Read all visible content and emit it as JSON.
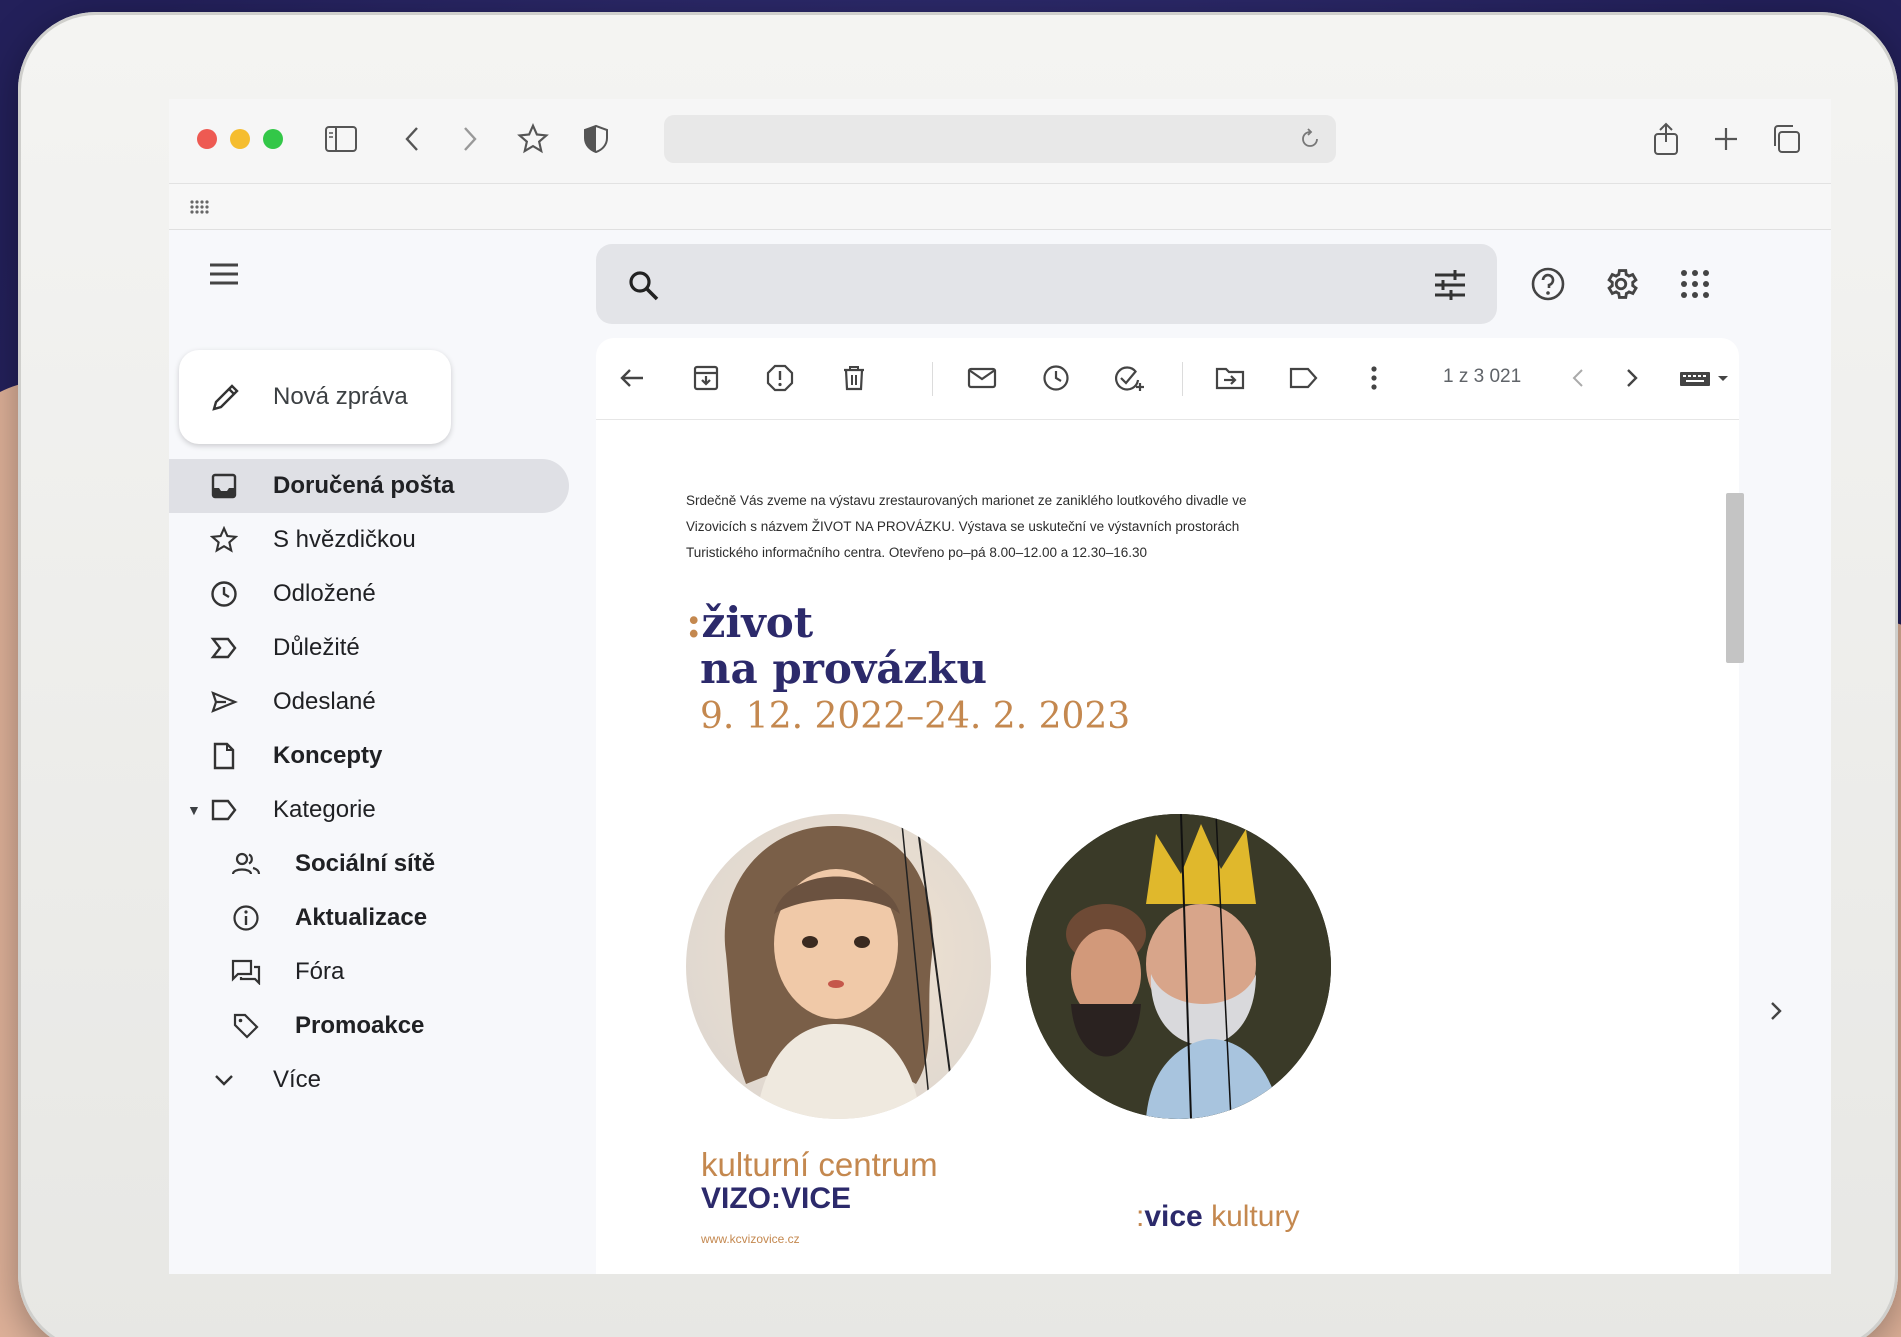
{
  "colors": {
    "accent_navy": "#2c2a6b",
    "accent_copper": "#c4884f",
    "traffic_red": "#ee5a52",
    "traffic_yellow": "#f5bd2f",
    "traffic_green": "#33c748"
  },
  "compose": {
    "label": "Nová zpráva"
  },
  "nav": {
    "inbox": "Doručená pošta",
    "starred": "S hvězdičkou",
    "snoozed": "Odložené",
    "important": "Důležité",
    "sent": "Odeslané",
    "drafts": "Koncepty",
    "categories": "Kategorie",
    "social": "Sociální sítě",
    "updates": "Aktualizace",
    "forums": "Fóra",
    "promotions": "Promoakce",
    "more": "Více"
  },
  "toolbar": {
    "pager": "1 z 3 021"
  },
  "email": {
    "intro": "Srdečně Vás zveme na výstavu zrestaurovaných marionet ze zaniklého loutkového divadle ve Vizovicích s názvem ŽIVOT NA PROVÁZKU. Výstava se uskuteční ve výstavních prostorách Turistického informačního centra. Otevřeno po–pá 8.00–12.00 a 12.30–16.30",
    "title_colon": ":",
    "title_line1": "život",
    "title_line2": "na provázku",
    "dates": "9. 12. 2022–24. 2. 2023",
    "brand_line1": "kulturní centrum",
    "brand_line2": "VIZO:VICE",
    "url": "www.kcvizovice.cz",
    "tag_colon": ":",
    "tag_word1": "vice",
    "tag_word2": "kultury"
  }
}
